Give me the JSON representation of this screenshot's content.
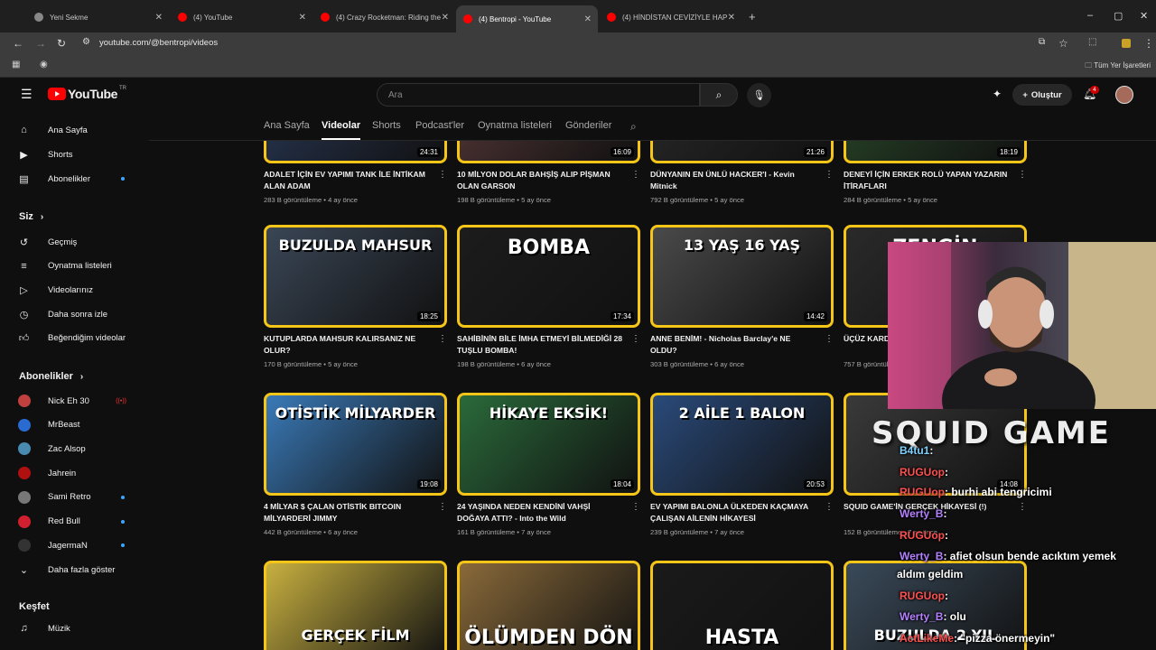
{
  "browser": {
    "tabs": [
      {
        "title": "Yeni Sekme",
        "icon": "chrome-icon",
        "active": false
      },
      {
        "title": "(4) YouTube",
        "icon": "youtube-icon",
        "active": false
      },
      {
        "title": "(4) Crazy Rocketman: Riding the",
        "icon": "youtube-icon",
        "active": false
      },
      {
        "title": "(4) Bentropi - YouTube",
        "icon": "youtube-icon",
        "active": true
      },
      {
        "title": "(4) HİNDİSTAN CEVİZİYLE HAP",
        "icon": "youtube-icon",
        "active": false
      }
    ],
    "url": "youtube.com/@bentropi/videos",
    "bookmarks_all": "Tüm Yer İşaretleri"
  },
  "youtube": {
    "logo": "YouTube",
    "country": "TR",
    "search_placeholder": "Ara",
    "create_label": "Oluştur",
    "notif_count": "4"
  },
  "sidebar": {
    "main": [
      {
        "label": "Ana Sayfa",
        "icon": "home-icon"
      },
      {
        "label": "Shorts",
        "icon": "shorts-icon"
      },
      {
        "label": "Abonelikler",
        "icon": "subscriptions-icon",
        "dot": true
      }
    ],
    "you_title": "Siz",
    "you": [
      {
        "label": "Geçmiş",
        "icon": "history-icon"
      },
      {
        "label": "Oynatma listeleri",
        "icon": "playlist-icon"
      },
      {
        "label": "Videolarınız",
        "icon": "your-videos-icon"
      },
      {
        "label": "Daha sonra izle",
        "icon": "watch-later-icon"
      },
      {
        "label": "Beğendiğim videolar",
        "icon": "like-icon"
      }
    ],
    "subs_title": "Abonelikler",
    "subs": [
      {
        "label": "Nick Eh 30",
        "color": "#c04040",
        "live": true
      },
      {
        "label": "MrBeast",
        "color": "#2a6bd1"
      },
      {
        "label": "Zac Alsop",
        "color": "#4a8ab0"
      },
      {
        "label": "Jahrein",
        "color": "#b01010"
      },
      {
        "label": "Sami Retro",
        "color": "#777777",
        "dot": true
      },
      {
        "label": "Red Bull",
        "color": "#d02030",
        "dot": true
      },
      {
        "label": "JagermaN",
        "color": "#333333",
        "dot": true
      }
    ],
    "show_more": "Daha fazla göster",
    "explore_title": "Keşfet",
    "explore": [
      {
        "label": "Müzik",
        "icon": "music-icon"
      }
    ]
  },
  "channel_tabs": [
    "Ana Sayfa",
    "Videolar",
    "Shorts",
    "Podcast'ler",
    "Oynatma listeleri",
    "Gönderiler"
  ],
  "selected_tab": "Videolar",
  "videos": [
    {
      "title": "ADALET İÇİN EV YAPIMI TANK İLE İNTİKAM ALAN ADAM",
      "views": "283 B görüntüleme",
      "age": "4 ay önce",
      "duration": "24:31",
      "thumb_text": "",
      "bg": "#2a3a5a"
    },
    {
      "title": "10 MİLYON DOLAR BAHŞİŞ ALIP PİŞMAN OLAN GARSON",
      "views": "198 B görüntüleme",
      "age": "5 ay önce",
      "duration": "16:09",
      "thumb_text": "",
      "bg": "#5a3a3a"
    },
    {
      "title": "DÜNYANIN EN ÜNLÜ HACKER'I - Kevin Mitnick",
      "views": "792 B görüntüleme",
      "age": "5 ay önce",
      "duration": "21:26",
      "thumb_text": "",
      "bg": "#2a2a2a"
    },
    {
      "title": "DENEYİ İÇİN ERKEK ROLÜ YAPAN YAZARIN İTİRAFLARI",
      "views": "284 B görüntüleme",
      "age": "5 ay önce",
      "duration": "18:19",
      "thumb_text": "",
      "bg": "#2a4a2a"
    },
    {
      "title": "KUTUPLARDA MAHSUR KALIRSANIZ NE OLUR?",
      "views": "170 B görüntüleme",
      "age": "5 ay önce",
      "duration": "18:25",
      "thumb_text": "BUZULDA MAHSUR",
      "bg": "#3a4656"
    },
    {
      "title": "SAHİBİNİN BİLE İMHA ETMEYİ BİLMEDİĞİ 28 TUŞLU BOMBA!",
      "views": "198 B görüntüleme",
      "age": "6 ay önce",
      "duration": "17:34",
      "thumb_text": "BOMBA",
      "bg": "#1c1c1c"
    },
    {
      "title": "ANNE BENİM! - Nicholas Barclay'e NE OLDU?",
      "views": "303 B görüntüleme",
      "age": "6 ay önce",
      "duration": "14:42",
      "thumb_text": "13 YAŞ   16 YAŞ",
      "bg": "#4a4a4a"
    },
    {
      "title": "ÜÇÜZ KARDEŞ",
      "views": "757 B görüntüleme",
      "age": "6 ay önce",
      "duration": "",
      "thumb_text": "ZENGİN",
      "bg": "#2a2a2a"
    },
    {
      "title": "4 MİLYAR $ ÇALAN OTİSTİK BITCOIN MİLYARDERİ JIMMY",
      "views": "442 B görüntüleme",
      "age": "6 ay önce",
      "duration": "19:08",
      "thumb_text": "OTİSTİK MİLYARDER",
      "bg": "#3a7ab8"
    },
    {
      "title": "24 YAŞINDA NEDEN KENDİNİ VAHŞİ DOĞAYA ATTI? - Into the Wild",
      "views": "161 B görüntüleme",
      "age": "7 ay önce",
      "duration": "18:04",
      "thumb_text": "HİKAYE EKSİK!",
      "bg": "#2a6a3a"
    },
    {
      "title": "EV YAPIMI BALONLA ÜLKEDEN KAÇMAYA ÇALIŞAN AİLENİN HİKAYESİ",
      "views": "239 B görüntüleme",
      "age": "7 ay önce",
      "duration": "20:53",
      "thumb_text": "2 AİLE 1 BALON",
      "bg": "#2a4a7a"
    },
    {
      "title": "SQUID GAME'İN GERÇEK HİKAYESİ (!)",
      "views": "152 B görüntüleme",
      "age": "7 ay önce",
      "duration": "14:08",
      "thumb_text": "",
      "bg": "#3a3a3a"
    },
    {
      "title": "",
      "views": "",
      "age": "",
      "duration": "",
      "thumb_text": "GERÇEK   FİLM",
      "bg": "#c8b040"
    },
    {
      "title": "",
      "views": "",
      "age": "",
      "duration": "",
      "thumb_text": "ÖLÜMDEN DÖN",
      "bg": "#8a6a3a"
    },
    {
      "title": "",
      "views": "",
      "age": "",
      "duration": "",
      "thumb_text": "HASTA",
      "bg": "#1a1a1a"
    },
    {
      "title": "",
      "views": "",
      "age": "",
      "duration": "",
      "thumb_text": "BUZULDA 2 YIL",
      "bg": "#3a4a5a"
    }
  ],
  "overlay": {
    "logo_text": "SQUID GAME",
    "chat": [
      {
        "user": "B4tu1",
        "msg": ":",
        "cls": "g"
      },
      {
        "user": "RUGUop",
        "msg": ":",
        "cls": "u"
      },
      {
        "user": "RUGUop",
        "msg": ": burhi abi tengricimi",
        "cls": "u"
      },
      {
        "user": "Werty_B",
        "msg": ":",
        "cls": "p"
      },
      {
        "user": "RUGUop",
        "msg": ":",
        "cls": "u"
      },
      {
        "user": "Werty_B",
        "msg": ": afiet olsun bende acıktım yemek",
        "cls": "p"
      },
      {
        "user": "",
        "msg": "aldım geldim",
        "cls": "p"
      },
      {
        "user": "RUGUop",
        "msg": ":",
        "cls": "u"
      },
      {
        "user": "Werty_B",
        "msg": ": olu",
        "cls": "p"
      },
      {
        "user": "ActLikeMe",
        "msg": ": \"pizza önermeyin\"",
        "cls": "u"
      }
    ]
  }
}
